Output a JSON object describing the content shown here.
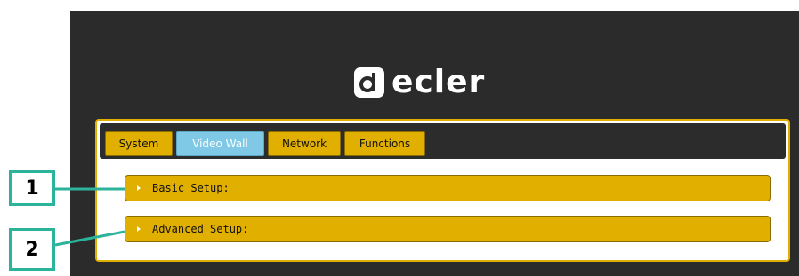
{
  "brand": {
    "name": "ecler",
    "logo_glyph": "d"
  },
  "tabs": [
    {
      "label": "System",
      "active": false
    },
    {
      "label": "Video Wall",
      "active": true
    },
    {
      "label": "Network",
      "active": false
    },
    {
      "label": "Functions",
      "active": false
    }
  ],
  "sections": [
    {
      "label": "Basic Setup:",
      "expanded": false
    },
    {
      "label": "Advanced Setup:",
      "expanded": false
    }
  ],
  "callouts": [
    "1",
    "2"
  ],
  "colors": {
    "background": "#2b2b2b",
    "accent": "#e1af00",
    "active_tab": "#7fc9e6",
    "callout": "#2bb39b"
  }
}
